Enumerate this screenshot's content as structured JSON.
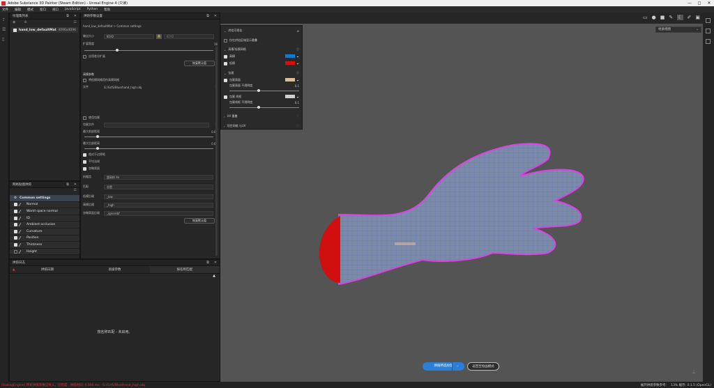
{
  "window": {
    "title": "Adobe Substance 3D Painter (Steam Edition) - Unreal Engine 4 (只读)",
    "min": "—",
    "max": "◻",
    "close": "✕"
  },
  "menu": [
    "文件",
    "编辑",
    "模式",
    "窗口",
    "视口",
    "JavaScript",
    "Python",
    "帮助"
  ],
  "texset": {
    "title": "纹理集列表",
    "item": "hand_low_defaultMat",
    "size": "4096x4096"
  },
  "bakemaps": {
    "title": "网格贴图烘焙",
    "items": [
      "Common settings",
      "Normal",
      "World space normal",
      "ID",
      "Ambient occlusion",
      "Curvature",
      "Position",
      "Thickness",
      "Height"
    ]
  },
  "bake": {
    "title": "烘焙参数设置",
    "breadcrumb": "hand_low_defaultMat  >  Common settings",
    "output_size_label": "输出大小",
    "output_size": "8192",
    "output_size2": "8192",
    "dilation_label": "扩展宽度",
    "dilation": "16",
    "apply_diff_label": "应用差分扩展",
    "reset1": "恢复默认值",
    "hp_title": "高模参数",
    "use_lp_label": "将低模网格用作高模网格",
    "mesh_label": "文件",
    "mesh_path": "G:/GrtS/Blue/hand_high.obj",
    "cage_label": "使用包裹",
    "cage_file_label": "包裹文件",
    "frontal_label": "最大前部距离",
    "frontal": "0.01",
    "rear_label": "最大后部距离",
    "rear": "0.01",
    "relative_label": "相对于边界框",
    "average_label": "平均法线",
    "ignore_label": "忽略背面",
    "aa_label": "抗锯齿",
    "aa": "超采样 4x",
    "match_label": "匹配",
    "match": "总是",
    "lp_suffix_label": "低模后缀",
    "lp_suffix": "_low",
    "hp_suffix_label": "高模后缀",
    "hp_suffix": "_high",
    "ignore_suffix_label": "忽略背面后缀",
    "ignore_suffix": "_ignorebf",
    "reset2": "恢复默认值"
  },
  "log": {
    "title": "烘焙日志",
    "tabs": [
      "烘焙日期",
      "高级参数",
      "按名称匹配"
    ],
    "message": "按名称匹配 - 未启用。"
  },
  "overlay": {
    "title": "烘焙可视化",
    "show_label": "仅在烘焙区域显示重叠",
    "hp_title": "高模/低模网格",
    "hp_right": "高模",
    "lp_right": "低模",
    "hp_color": "#1678c8",
    "lp_color": "#d40f0f",
    "hp_label": "高模",
    "lp_label": "低模 网格",
    "cage_title": "包裹",
    "cage_show": "包裹表面",
    "cage_opacity_label": "包裹表面 不透明度",
    "cage_opacity": "0.1",
    "cage_wire": "包裹 线框",
    "cage_wire_opacity_label": "包裹线框 不透明度",
    "cage_wire_opacity": "0.1",
    "cage_color": "#d8c09a",
    "cage_wire_color": "#d0d0d0",
    "uv_title": "UV 重叠",
    "sub_title": "项目网格 与UV"
  },
  "viewport": {
    "view_mode": "材质视图",
    "bake_button": "烘焙所选纹理",
    "exit_button": "返回至绘画模式"
  },
  "status": {
    "left": "[BakingEngine] 所有烘焙参数已导入，已完成 · 烘焙时间: 0.000 ms · G:/GrtS/Blue/hand_high.obj",
    "right1": "展开烘焙参数参考:",
    "right2": "13%  缓存: 0.1.5 (OpenGL)"
  }
}
